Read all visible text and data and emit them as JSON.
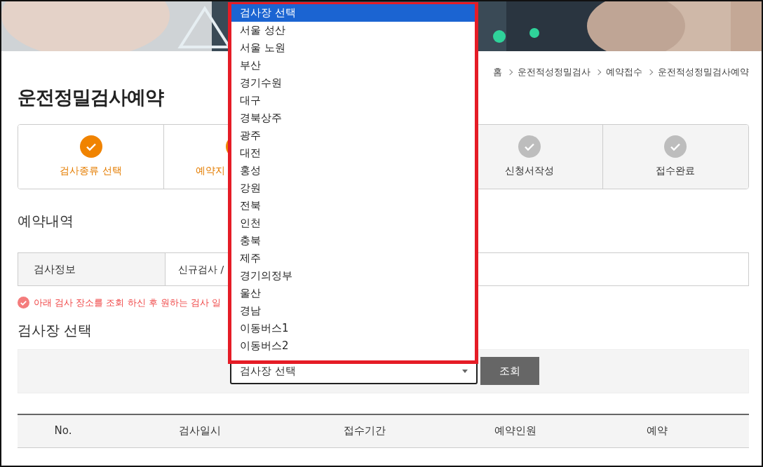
{
  "banner": {
    "kind": "picture"
  },
  "breadcrumb": [
    "홈",
    "운전적성정밀검사",
    "예약접수",
    "운전적성정밀검사예약"
  ],
  "page_title": "운전정밀검사예약",
  "steps": [
    {
      "label": "검사종류 선택",
      "done": true
    },
    {
      "label": "예약지",
      "done": true
    },
    {
      "label": "신청서작성",
      "done": false
    },
    {
      "label": "접수완료",
      "done": false
    }
  ],
  "reservation_heading": "예약내역",
  "info_row": {
    "label": "검사정보",
    "value": "신규검사 /"
  },
  "notice": "아래 검사 장소를 조회 하신 후 원하는 검사 일",
  "site_heading": "검사장 선택",
  "site_select": {
    "value": "검사장 선택",
    "expanded": true,
    "options": [
      {
        "label": "검사장 선택",
        "selected": true
      },
      {
        "label": "서울 성산",
        "selected": false
      },
      {
        "label": "서울 노원",
        "selected": false
      },
      {
        "label": "부산",
        "selected": false
      },
      {
        "label": "경기수원",
        "selected": false
      },
      {
        "label": "대구",
        "selected": false
      },
      {
        "label": "경북상주",
        "selected": false
      },
      {
        "label": "광주",
        "selected": false
      },
      {
        "label": "대전",
        "selected": false
      },
      {
        "label": "홍성",
        "selected": false
      },
      {
        "label": "강원",
        "selected": false
      },
      {
        "label": "전북",
        "selected": false
      },
      {
        "label": "인천",
        "selected": false
      },
      {
        "label": "충북",
        "selected": false
      },
      {
        "label": "제주",
        "selected": false
      },
      {
        "label": "경기의정부",
        "selected": false
      },
      {
        "label": "울산",
        "selected": false
      },
      {
        "label": "경남",
        "selected": false
      },
      {
        "label": "이동버스1",
        "selected": false
      },
      {
        "label": "이동버스2",
        "selected": false
      }
    ]
  },
  "search_button": "조회",
  "table": {
    "columns": [
      "No.",
      "검사일시",
      "접수기간",
      "예약인원",
      "예약"
    ]
  }
}
